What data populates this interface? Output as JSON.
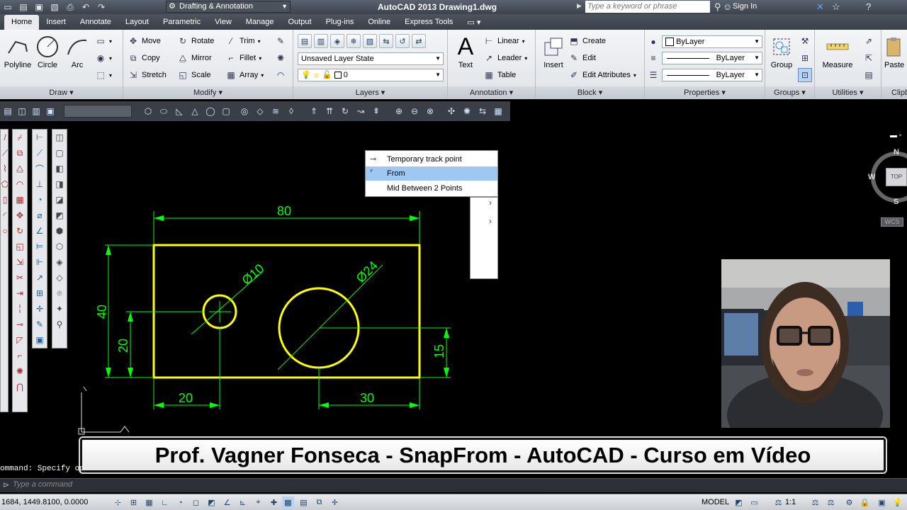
{
  "titlebar": {
    "workspace": "Drafting & Annotation",
    "app_title": "AutoCAD 2013   Drawing1.dwg",
    "search_placeholder": "Type a keyword or phrase",
    "sign_in": "Sign In"
  },
  "ribbon_tabs": [
    "Home",
    "Insert",
    "Annotate",
    "Layout",
    "Parametric",
    "View",
    "Manage",
    "Output",
    "Plug-ins",
    "Online",
    "Express Tools"
  ],
  "panels": {
    "draw": {
      "title": "Draw",
      "polyline": "Polyline",
      "circle": "Circle",
      "arc": "Arc"
    },
    "modify": {
      "title": "Modify",
      "move": "Move",
      "rotate": "Rotate",
      "trim": "Trim",
      "copy": "Copy",
      "mirror": "Mirror",
      "fillet": "Fillet",
      "stretch": "Stretch",
      "scale": "Scale",
      "array": "Array"
    },
    "layers": {
      "title": "Layers",
      "layer_state": "Unsaved Layer State",
      "current_layer": "0"
    },
    "annotation": {
      "title": "Annotation",
      "text": "Text",
      "linear": "Linear",
      "leader": "Leader",
      "table": "Table"
    },
    "block": {
      "title": "Block",
      "insert": "Insert",
      "create": "Create",
      "edit": "Edit",
      "edit_attributes": "Edit Attributes"
    },
    "properties": {
      "title": "Properties",
      "color": "ByLayer",
      "linetype": "ByLayer",
      "lineweight": "ByLayer"
    },
    "groups": {
      "title": "Groups",
      "group": "Group"
    },
    "utilities": {
      "title": "Utilities",
      "measure": "Measure"
    },
    "clipboard": {
      "title": "Clipb",
      "paste": "Paste"
    }
  },
  "drawing": {
    "dims": {
      "width": "80",
      "height": "40",
      "small_hole_dia": "Ø10",
      "big_hole_dia": "Ø24",
      "small_hole_y": "20",
      "small_hole_x": "20",
      "big_hole_x": "30",
      "big_hole_y": "15"
    },
    "colors": {
      "geometry": "#ffff00",
      "dimension": "#00ff00",
      "background": "#000000"
    }
  },
  "context_menu": {
    "items": [
      "Temporary track point",
      "From",
      "Mid Between 2 Points"
    ],
    "highlighted": "From"
  },
  "viewcube": {
    "north": "N",
    "west": "W",
    "south": "S",
    "top": "TOP",
    "wcs": "WCS"
  },
  "caption": "Prof. Vagner Fonseca - SnapFrom -  AutoCAD - Curso em Vídeo",
  "command": {
    "history": "ommand: Specify opp",
    "input_placeholder": "Type a command"
  },
  "statusbar": {
    "coords": "1684, 1449.8100, 0.0000",
    "model": "MODEL",
    "scale": "1:1"
  }
}
